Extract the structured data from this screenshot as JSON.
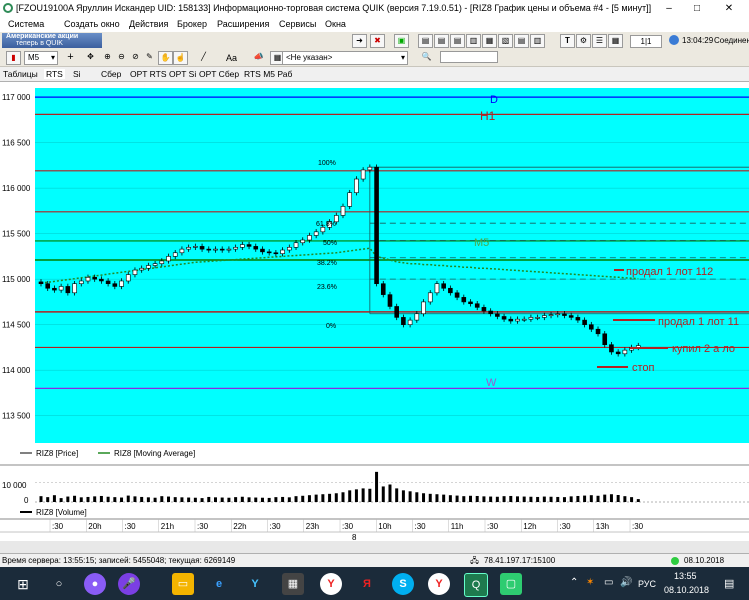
{
  "window": {
    "title": "[FZOU19100A Яруллин Искандер UID: 158133] Информационно-торговая система QUIK (версия 7.19.0.51) - [RIZ8 График цены и объема #4 - [5 минут]]",
    "minimize": "–",
    "restore": "□",
    "close": "✕"
  },
  "menu": [
    "Система",
    "Создать окно",
    "Действия",
    "Брокер",
    "Расширения",
    "Сервисы",
    "Окна"
  ],
  "toolbar1": {
    "banner_line1": "Американские акции",
    "banner_line2": "теперь в QUIK",
    "page": "1|1",
    "clock": "13:04:29",
    "connection": "Соединен"
  },
  "toolbar2": {
    "interval": "M5",
    "font": "Aa",
    "account": "<Не указан>",
    "search_value": ""
  },
  "tabs": [
    "Таблицы",
    "RTS",
    "Si",
    "Сбер",
    "OPT RTS",
    "OPT Si",
    "OPT Сбер",
    "RTS M5 Раб"
  ],
  "chart": {
    "price_ticks": [
      "117 000",
      "116 500",
      "116 000",
      "115 500",
      "115 000",
      "114 500",
      "114 000",
      "113 500"
    ],
    "level_labels": {
      "D": "D",
      "H1": "H1",
      "M5": "M5",
      "W": "W"
    },
    "fib_labels": [
      "100%",
      "61.8%",
      "50%",
      "38.2%",
      "23.6%",
      "0%"
    ],
    "annotations": {
      "sell1": "продал 1 лот 112",
      "sell2": "продал 1 лот 11",
      "buy": "купил 2 а ло",
      "stop": "стоп"
    },
    "legend_price": "RIZ8 [Price]",
    "legend_ma": "RIZ8 [Moving Average]",
    "volume_tick": "10 000",
    "volume_zero": "0",
    "legend_volume": "RIZ8 [Volume]",
    "time_labels": [
      ":30",
      "20h",
      ":30",
      "21h",
      ":30",
      "22h",
      ":30",
      "23h",
      ":30",
      "10h",
      ":30",
      "11h",
      ":30",
      "12h",
      ":30",
      "13h",
      ":30"
    ],
    "date_marker": "8",
    "colors": {
      "background": "#00ffff",
      "level_red": "#b22222",
      "level_blue": "#0000ff",
      "level_green": "#008000",
      "level_purple": "#8a2be2",
      "ma_green": "#228b22"
    }
  },
  "chart_data": {
    "type": "line",
    "ylim": [
      113200,
      117100
    ],
    "levels": [
      {
        "name": "D",
        "value": 117000
      },
      {
        "name": "H1",
        "value": 116810
      },
      {
        "name": "",
        "value": 116190
      },
      {
        "name": "",
        "value": 115740
      },
      {
        "name": "M5",
        "value": 115420
      },
      {
        "name": "",
        "value": 115210
      },
      {
        "name": "",
        "value": 114640
      },
      {
        "name": "",
        "value": 114250
      },
      {
        "name": "W",
        "value": 113800
      }
    ],
    "close": [
      114950,
      114900,
      114880,
      114920,
      114850,
      114950,
      114980,
      115020,
      115000,
      114980,
      114950,
      114920,
      114980,
      115050,
      115100,
      115120,
      115150,
      115170,
      115200,
      115250,
      115290,
      115330,
      115350,
      115360,
      115330,
      115320,
      115330,
      115320,
      115330,
      115350,
      115380,
      115360,
      115330,
      115300,
      115290,
      115280,
      115320,
      115350,
      115400,
      115430,
      115480,
      115520,
      115570,
      115630,
      115700,
      115800,
      115950,
      116100,
      116200,
      116230,
      114950,
      114830,
      114700,
      114580,
      114500,
      114550,
      114620,
      114750,
      114850,
      114950,
      114900,
      114850,
      114800,
      114750,
      114730,
      114690,
      114650,
      114620,
      114590,
      114560,
      114540,
      114560,
      114560,
      114580,
      114580,
      114600,
      114610,
      114620,
      114600,
      114580,
      114550,
      114500,
      114450,
      114400,
      114280,
      114200,
      114180,
      114220,
      114250,
      114270
    ],
    "ma": [
      114960,
      114965,
      114975,
      114985,
      114995,
      115005,
      115015,
      115025,
      115035,
      115045,
      115055,
      115065,
      115075,
      115085,
      115095,
      115105,
      115115,
      115125,
      115135,
      115145,
      115155,
      115165,
      115175,
      115185,
      115190,
      115195,
      115200,
      115205,
      115210,
      115215,
      115220,
      115225,
      115230,
      115235,
      115240,
      115245,
      115250,
      115255,
      115260,
      115265,
      115270,
      115275,
      115280,
      115285,
      115290,
      115300,
      115310,
      115320,
      115330,
      115340,
      115250,
      115230,
      115210,
      115190,
      115180,
      115170,
      115170,
      115160,
      115160,
      115150,
      115150,
      115140,
      115140,
      115130,
      115130,
      115120,
      115120,
      115115,
      115110,
      115105,
      115100,
      115095,
      115090,
      115085,
      115080,
      115075,
      115070,
      115065,
      115060,
      115055,
      115050,
      115045,
      115040,
      115035,
      115030,
      115025,
      115020,
      115015,
      115010,
      115005
    ],
    "volume": [
      3000,
      2500,
      3500,
      2000,
      2800,
      3200,
      2400,
      2600,
      2900,
      3100,
      2700,
      2500,
      2300,
      3300,
      2900,
      2600,
      2400,
      2200,
      3000,
      2800,
      2500,
      2400,
      2300,
      2200,
      2000,
      2600,
      2400,
      2300,
      2200,
      2500,
      2700,
      2400,
      2300,
      2200,
      2100,
      2500,
      2600,
      2400,
      3000,
      3200,
      3500,
      3800,
      4000,
      4200,
      4500,
      5000,
      6000,
      6500,
      7000,
      6800,
      15500,
      8000,
      9000,
      7000,
      6000,
      5500,
      5000,
      4500,
      4200,
      4000,
      3800,
      3500,
      3300,
      3000,
      3200,
      3100,
      2900,
      2800,
      2700,
      3000,
      3100,
      2900,
      2800,
      2700,
      2600,
      2800,
      2700,
      2600,
      2500,
      2900,
      3100,
      3300,
      3500,
      3200,
      3800,
      4000,
      3600,
      3000,
      2500,
      1500
    ],
    "volume_ylim": [
      0,
      18000
    ]
  },
  "status_bar": {
    "server_time": "Время сервера: 13:55:15; записей: 5455048; текущая: 6269149",
    "ip": "78.41.197.17:15100",
    "date": "08.10.2018"
  },
  "taskbar": {
    "lang": "РУС",
    "time": "13:55",
    "date": "08.10.2018"
  }
}
